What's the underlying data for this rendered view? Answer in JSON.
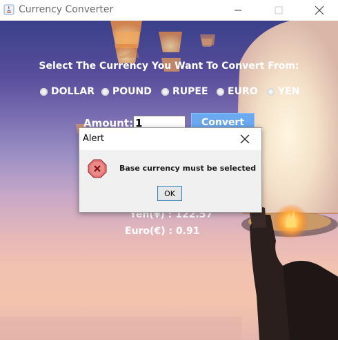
{
  "window": {
    "title": "Currency Converter"
  },
  "main": {
    "heading": "Select The Currency You Want To Convert From:",
    "currencies": [
      {
        "label": "DOLLAR"
      },
      {
        "label": "POUND"
      },
      {
        "label": "RUPEE"
      },
      {
        "label": "EURO"
      },
      {
        "label": "YEN"
      }
    ],
    "amount_label": "Amount:",
    "amount_value": "1",
    "convert_label": "Convert",
    "results": [
      {
        "text": "Yen(¥) :    122.57"
      },
      {
        "text": "Euro(€) :     0.91"
      }
    ]
  },
  "dialog": {
    "title": "Alert",
    "message": "Base currency must be selected",
    "ok_label": "OK"
  },
  "colors": {
    "accent": "#6aa8f0",
    "error": "#d24a4a"
  }
}
